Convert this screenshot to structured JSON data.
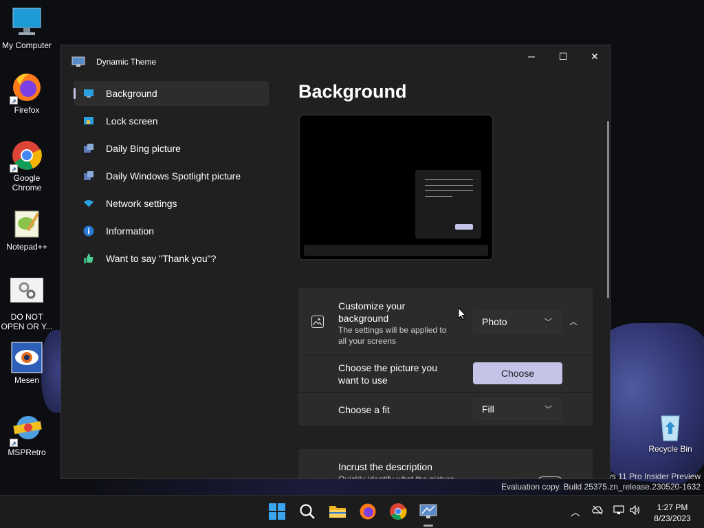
{
  "desktop": {
    "icons": [
      {
        "label": "My Computer",
        "icon": "computer-icon"
      },
      {
        "label": "Firefox",
        "icon": "firefox-icon"
      },
      {
        "label": "Google Chrome",
        "icon": "chrome-icon"
      },
      {
        "label": "Notepad++",
        "icon": "notepadpp-icon"
      },
      {
        "label": "DO NOT OPEN OR Y...",
        "icon": "settings-file-icon"
      },
      {
        "label": "Mesen",
        "icon": "mesen-icon"
      },
      {
        "label": "MSPRetro",
        "icon": "mspretro-icon"
      },
      {
        "label": "Recycle Bin",
        "icon": "recycle-bin-icon"
      }
    ],
    "watermark_line1": "ws 11 Pro Insider Preview",
    "watermark_line2": "Evaluation copy. Build 25375.zn_release.230520-1632"
  },
  "window": {
    "title": "Dynamic Theme",
    "controls": {
      "minimize": "─",
      "maximize": "☐",
      "close": "✕"
    }
  },
  "nav": {
    "items": [
      {
        "label": "Background",
        "icon": "monitor-icon",
        "active": true
      },
      {
        "label": "Lock screen",
        "icon": "lock-screen-icon",
        "active": false
      },
      {
        "label": "Daily Bing picture",
        "icon": "bing-picture-icon",
        "active": false
      },
      {
        "label": "Daily Windows Spotlight picture",
        "icon": "spotlight-picture-icon",
        "active": false
      },
      {
        "label": "Network settings",
        "icon": "wifi-icon",
        "active": false
      },
      {
        "label": "Information",
        "icon": "info-icon",
        "active": false
      },
      {
        "label": "Want to say \"Thank you\"?",
        "icon": "thumbs-up-icon",
        "active": false
      }
    ]
  },
  "content": {
    "title": "Background",
    "customize": {
      "title_line1": "Customize your",
      "title_line2": "background",
      "desc_line1": "The settings will be applied to",
      "desc_line2": "all your screens",
      "mode_value": "Photo"
    },
    "choose_picture": {
      "label_line1": "Choose the picture you",
      "label_line2": "want to use",
      "button_label": "Choose"
    },
    "fit": {
      "label": "Choose a fit",
      "value": "Fill"
    },
    "incrust": {
      "title": "Incrust the description",
      "desc": "Quickly identify what the picture"
    }
  },
  "taskbar": {
    "icons": [
      "windows-start-icon",
      "search-icon",
      "file-explorer-icon",
      "firefox-icon",
      "chrome-icon",
      "dynamic-theme-icon"
    ],
    "tray": [
      "chevron-up-icon",
      "cloud-offline-icon",
      "network-icon",
      "volume-icon"
    ],
    "time": "1:27 PM",
    "date": "8/23/2023"
  },
  "colors": {
    "accent": "#c4c4e8",
    "window_bg": "#202020",
    "card_bg": "#2b2b2b"
  }
}
